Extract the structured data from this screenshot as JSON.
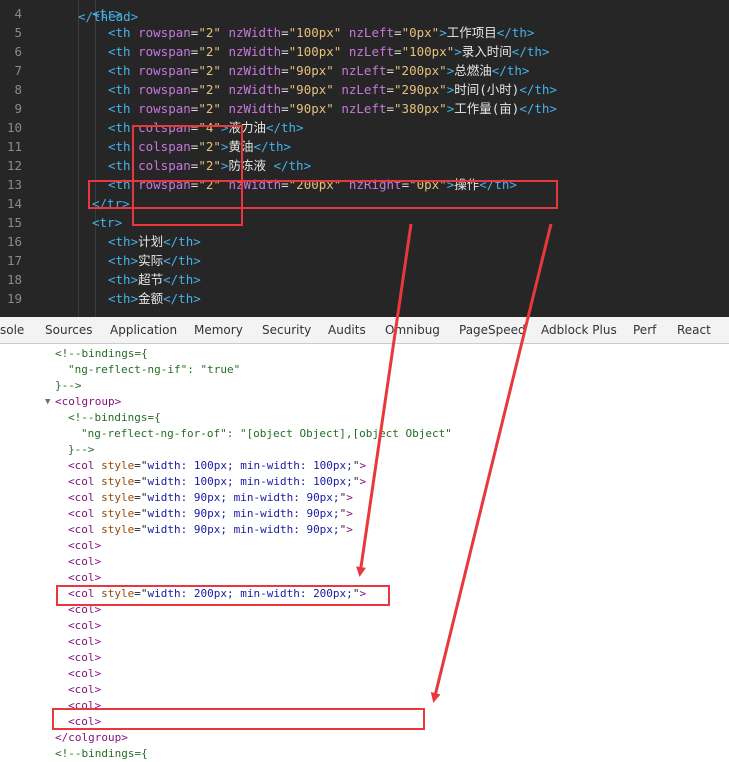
{
  "editor": {
    "lines": [
      {
        "n": "4",
        "indent": 0,
        "tokens": [
          [
            "tag",
            "<tr>"
          ]
        ]
      },
      {
        "n": "5",
        "indent": 1,
        "tokens": [
          [
            "tag",
            "<th "
          ],
          [
            "attr",
            "rowspan"
          ],
          [
            "punct",
            "="
          ],
          [
            "str",
            "\"2\""
          ],
          [
            "punct",
            " "
          ],
          [
            "attr",
            "nzWidth"
          ],
          [
            "punct",
            "="
          ],
          [
            "str",
            "\"100px\""
          ],
          [
            "punct",
            " "
          ],
          [
            "attr",
            "nzLeft"
          ],
          [
            "punct",
            "="
          ],
          [
            "str",
            "\"0px\""
          ],
          [
            "tag",
            ">"
          ],
          [
            "text",
            "工作项目"
          ],
          [
            "tag",
            "</th>"
          ]
        ]
      },
      {
        "n": "6",
        "indent": 1,
        "tokens": [
          [
            "tag",
            "<th "
          ],
          [
            "attr",
            "rowspan"
          ],
          [
            "punct",
            "="
          ],
          [
            "str",
            "\"2\""
          ],
          [
            "punct",
            " "
          ],
          [
            "attr",
            "nzWidth"
          ],
          [
            "punct",
            "="
          ],
          [
            "str",
            "\"100px\""
          ],
          [
            "punct",
            " "
          ],
          [
            "attr",
            "nzLeft"
          ],
          [
            "punct",
            "="
          ],
          [
            "str",
            "\"100px\""
          ],
          [
            "tag",
            ">"
          ],
          [
            "text",
            "录入时间"
          ],
          [
            "tag",
            "</th>"
          ]
        ]
      },
      {
        "n": "7",
        "indent": 1,
        "tokens": [
          [
            "tag",
            "<th "
          ],
          [
            "attr",
            "rowspan"
          ],
          [
            "punct",
            "="
          ],
          [
            "str",
            "\"2\""
          ],
          [
            "punct",
            " "
          ],
          [
            "attr",
            "nzWidth"
          ],
          [
            "punct",
            "="
          ],
          [
            "str",
            "\"90px\""
          ],
          [
            "punct",
            " "
          ],
          [
            "attr",
            "nzLeft"
          ],
          [
            "punct",
            "="
          ],
          [
            "str",
            "\"200px\""
          ],
          [
            "tag",
            ">"
          ],
          [
            "text",
            "总燃油"
          ],
          [
            "tag",
            "</th>"
          ]
        ]
      },
      {
        "n": "8",
        "indent": 1,
        "tokens": [
          [
            "tag",
            "<th "
          ],
          [
            "attr",
            "rowspan"
          ],
          [
            "punct",
            "="
          ],
          [
            "str",
            "\"2\""
          ],
          [
            "punct",
            " "
          ],
          [
            "attr",
            "nzWidth"
          ],
          [
            "punct",
            "="
          ],
          [
            "str",
            "\"90px\""
          ],
          [
            "punct",
            " "
          ],
          [
            "attr",
            "nzLeft"
          ],
          [
            "punct",
            "="
          ],
          [
            "str",
            "\"290px\""
          ],
          [
            "tag",
            ">"
          ],
          [
            "text",
            "时间(小时)"
          ],
          [
            "tag",
            "</th>"
          ]
        ]
      },
      {
        "n": "9",
        "indent": 1,
        "tokens": [
          [
            "tag",
            "<th "
          ],
          [
            "attr",
            "rowspan"
          ],
          [
            "punct",
            "="
          ],
          [
            "str",
            "\"2\""
          ],
          [
            "punct",
            " "
          ],
          [
            "attr",
            "nzWidth"
          ],
          [
            "punct",
            "="
          ],
          [
            "str",
            "\"90px\""
          ],
          [
            "punct",
            " "
          ],
          [
            "attr",
            "nzLeft"
          ],
          [
            "punct",
            "="
          ],
          [
            "str",
            "\"380px\""
          ],
          [
            "tag",
            ">"
          ],
          [
            "text",
            "工作量(亩)"
          ],
          [
            "tag",
            "</th>"
          ]
        ]
      },
      {
        "n": "10",
        "indent": 1,
        "tokens": [
          [
            "tag",
            "<th "
          ],
          [
            "attr",
            "colspan"
          ],
          [
            "punct",
            "="
          ],
          [
            "str",
            "\"4\""
          ],
          [
            "tag",
            ">"
          ],
          [
            "text",
            "液力油"
          ],
          [
            "tag",
            "</th>"
          ]
        ]
      },
      {
        "n": "11",
        "indent": 1,
        "tokens": [
          [
            "tag",
            "<th "
          ],
          [
            "attr",
            "colspan"
          ],
          [
            "punct",
            "="
          ],
          [
            "str",
            "\"2\""
          ],
          [
            "tag",
            ">"
          ],
          [
            "text",
            "黄油"
          ],
          [
            "tag",
            "</th>"
          ]
        ]
      },
      {
        "n": "12",
        "indent": 1,
        "tokens": [
          [
            "tag",
            "<th "
          ],
          [
            "attr",
            "colspan"
          ],
          [
            "punct",
            "="
          ],
          [
            "str",
            "\"2\""
          ],
          [
            "tag",
            ">"
          ],
          [
            "text",
            "防冻液 "
          ],
          [
            "tag",
            "</th>"
          ]
        ]
      },
      {
        "n": "13",
        "indent": 1,
        "tokens": [
          [
            "tag",
            "<th "
          ],
          [
            "attr",
            "rowspan"
          ],
          [
            "punct",
            "="
          ],
          [
            "str",
            "\"2\""
          ],
          [
            "punct",
            " "
          ],
          [
            "attr",
            "nzWidth"
          ],
          [
            "punct",
            "="
          ],
          [
            "str",
            "\"200px\""
          ],
          [
            "punct",
            " "
          ],
          [
            "attr",
            "nzRight"
          ],
          [
            "punct",
            "="
          ],
          [
            "str",
            "\"0px\""
          ],
          [
            "tag",
            ">"
          ],
          [
            "text",
            "操作"
          ],
          [
            "tag",
            "</th>"
          ]
        ]
      },
      {
        "n": "14",
        "indent": 0,
        "tokens": [
          [
            "tag",
            "</tr>"
          ]
        ]
      },
      {
        "n": "15",
        "indent": 0,
        "tokens": [
          [
            "tag",
            "<tr>"
          ]
        ]
      },
      {
        "n": "16",
        "indent": 1,
        "tokens": [
          [
            "tag",
            "<th>"
          ],
          [
            "text",
            "计划"
          ],
          [
            "tag",
            "</th>"
          ]
        ]
      },
      {
        "n": "17",
        "indent": 1,
        "tokens": [
          [
            "tag",
            "<th>"
          ],
          [
            "text",
            "实际"
          ],
          [
            "tag",
            "</th>"
          ]
        ]
      },
      {
        "n": "18",
        "indent": 1,
        "tokens": [
          [
            "tag",
            "<th>"
          ],
          [
            "text",
            "超节"
          ],
          [
            "tag",
            "</th>"
          ]
        ]
      },
      {
        "n": "19",
        "indent": 1,
        "tokens": [
          [
            "tag",
            "<th>"
          ],
          [
            "text",
            "金额"
          ],
          [
            "tag",
            "</th>"
          ]
        ]
      }
    ]
  },
  "devtools": {
    "tabs": [
      "sole",
      "Sources",
      "Application",
      "Memory",
      "Security",
      "Audits",
      "Omnibug",
      "PageSpeed",
      "Adblock Plus",
      "Perf",
      "React"
    ]
  },
  "elements": {
    "lines": [
      {
        "indent": 0,
        "kind": "comment",
        "text": "<!--bindings={"
      },
      {
        "indent": 1,
        "kind": "comment",
        "text": "\"ng-reflect-ng-if\": \"true\""
      },
      {
        "indent": 0,
        "kind": "comment",
        "text": "}-->"
      },
      {
        "indent": 0,
        "kind": "tag",
        "triangle": "▼",
        "text": "<colgroup>"
      },
      {
        "indent": 1,
        "kind": "comment",
        "text": "<!--bindings={"
      },
      {
        "indent": 2,
        "kind": "comment",
        "text": "\"ng-reflect-ng-for-of\": \"[object Object],[object Object\""
      },
      {
        "indent": 1,
        "kind": "comment",
        "text": "}-->"
      },
      {
        "indent": 1,
        "kind": "col",
        "style": "width: 100px; min-width: 100px;"
      },
      {
        "indent": 1,
        "kind": "col",
        "style": "width: 100px; min-width: 100px;"
      },
      {
        "indent": 1,
        "kind": "col",
        "style": "width: 90px; min-width: 90px;"
      },
      {
        "indent": 1,
        "kind": "col",
        "style": "width: 90px; min-width: 90px;"
      },
      {
        "indent": 1,
        "kind": "col",
        "style": "width: 90px; min-width: 90px;"
      },
      {
        "indent": 1,
        "kind": "col",
        "style": ""
      },
      {
        "indent": 1,
        "kind": "col",
        "style": ""
      },
      {
        "indent": 1,
        "kind": "col",
        "style": ""
      },
      {
        "indent": 1,
        "kind": "col",
        "style": "width: 200px; min-width: 200px;"
      },
      {
        "indent": 1,
        "kind": "col",
        "style": ""
      },
      {
        "indent": 1,
        "kind": "col",
        "style": ""
      },
      {
        "indent": 1,
        "kind": "col",
        "style": ""
      },
      {
        "indent": 1,
        "kind": "col",
        "style": ""
      },
      {
        "indent": 1,
        "kind": "col",
        "style": ""
      },
      {
        "indent": 1,
        "kind": "col",
        "style": ""
      },
      {
        "indent": 1,
        "kind": "col",
        "style": ""
      },
      {
        "indent": 1,
        "kind": "col",
        "style": ""
      },
      {
        "indent": 0,
        "kind": "tag",
        "text": "</colgroup>"
      },
      {
        "indent": 0,
        "kind": "comment",
        "text": "<!--bindings={"
      }
    ]
  },
  "colors": {
    "annotation_red": "#e8383b",
    "editor_bg": "#262626"
  }
}
